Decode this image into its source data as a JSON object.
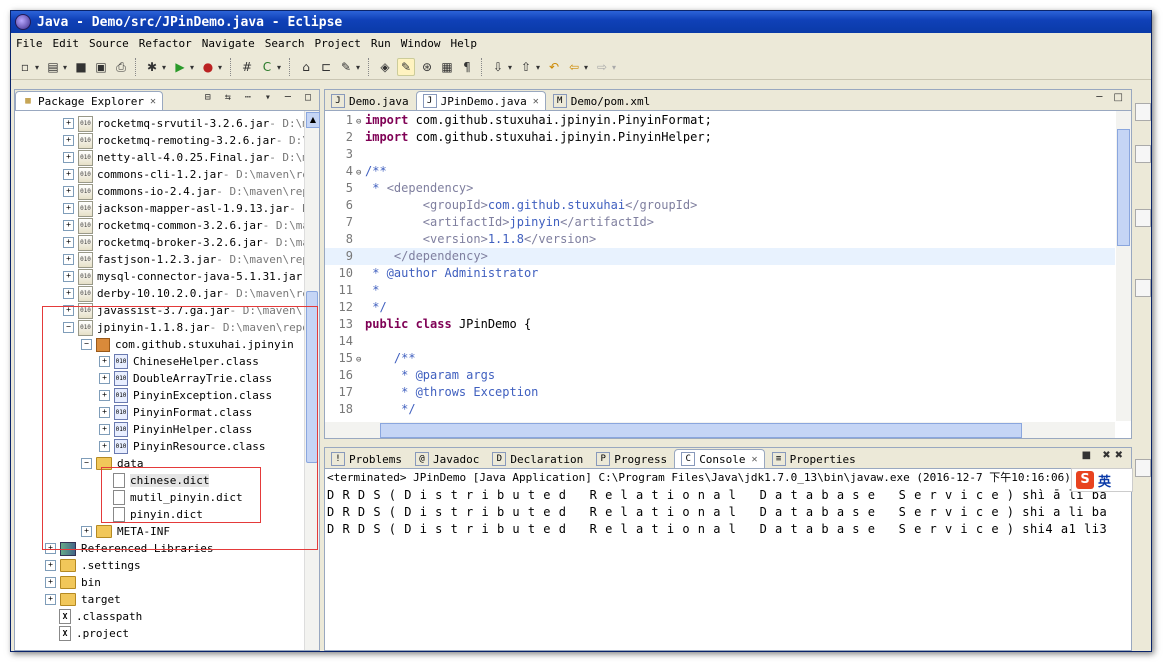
{
  "window": {
    "title": "Java - Demo/src/JPinDemo.java - Eclipse"
  },
  "menu": [
    "File",
    "Edit",
    "Source",
    "Refactor",
    "Navigate",
    "Search",
    "Project",
    "Run",
    "Window",
    "Help"
  ],
  "package_explorer": {
    "title": "Package Explorer",
    "items": [
      {
        "label": "rocketmq-srvutil-3.2.6.jar",
        "path": " - D:\\ma",
        "kind": "jar",
        "indent": 0
      },
      {
        "label": "rocketmq-remoting-3.2.6.jar",
        "path": " - D:\\m",
        "kind": "jar",
        "indent": 0
      },
      {
        "label": "netty-all-4.0.25.Final.jar",
        "path": " - D:\\ma",
        "kind": "jar",
        "indent": 0
      },
      {
        "label": "commons-cli-1.2.jar",
        "path": " - D:\\maven\\rep",
        "kind": "jar",
        "indent": 0
      },
      {
        "label": "commons-io-2.4.jar",
        "path": " - D:\\maven\\repo",
        "kind": "jar",
        "indent": 0
      },
      {
        "label": "jackson-mapper-asl-1.9.13.jar",
        "path": " - D:",
        "kind": "jar",
        "indent": 0
      },
      {
        "label": "rocketmq-common-3.2.6.jar",
        "path": " - D:\\mav",
        "kind": "jar",
        "indent": 0
      },
      {
        "label": "rocketmq-broker-3.2.6.jar",
        "path": " - D:\\mav",
        "kind": "jar",
        "indent": 0
      },
      {
        "label": "fastjson-1.2.3.jar",
        "path": " - D:\\maven\\repo",
        "kind": "jar",
        "indent": 0
      },
      {
        "label": "mysql-connector-java-5.1.31.jar",
        "path": " -",
        "kind": "jar",
        "indent": 0
      },
      {
        "label": "derby-10.10.2.0.jar",
        "path": " - D:\\maven\\rep",
        "kind": "jar",
        "indent": 0
      },
      {
        "label": "javassist-3.7.ga.jar",
        "path": " - D:\\maven\\re",
        "kind": "jar",
        "indent": 0
      },
      {
        "label": "jpinyin-1.1.8.jar",
        "path": " - D:\\maven\\repo\\",
        "kind": "jar",
        "indent": 0,
        "expanded": true
      },
      {
        "label": "com.github.stuxuhai.jpinyin",
        "path": "",
        "kind": "pkg",
        "indent": 1,
        "expanded": true
      },
      {
        "label": "ChineseHelper.class",
        "path": "",
        "kind": "cls",
        "indent": 2
      },
      {
        "label": "DoubleArrayTrie.class",
        "path": "",
        "kind": "cls",
        "indent": 2
      },
      {
        "label": "PinyinException.class",
        "path": "",
        "kind": "cls",
        "indent": 2
      },
      {
        "label": "PinyinFormat.class",
        "path": "",
        "kind": "cls",
        "indent": 2
      },
      {
        "label": "PinyinHelper.class",
        "path": "",
        "kind": "cls",
        "indent": 2
      },
      {
        "label": "PinyinResource.class",
        "path": "",
        "kind": "cls",
        "indent": 2
      },
      {
        "label": "data",
        "path": "",
        "kind": "fld",
        "indent": 1,
        "expanded": true
      },
      {
        "label": "chinese.dict",
        "path": "",
        "kind": "fil",
        "indent": 2,
        "selected": true
      },
      {
        "label": "mutil_pinyin.dict",
        "path": "",
        "kind": "fil",
        "indent": 2
      },
      {
        "label": "pinyin.dict",
        "path": "",
        "kind": "fil",
        "indent": 2
      },
      {
        "label": "META-INF",
        "path": "",
        "kind": "fld",
        "indent": 1
      },
      {
        "label": "Referenced Libraries",
        "path": "",
        "kind": "lib",
        "indent": -1
      },
      {
        "label": ".settings",
        "path": "",
        "kind": "fld",
        "indent": -1
      },
      {
        "label": "bin",
        "path": "",
        "kind": "fld",
        "indent": -1
      },
      {
        "label": "target",
        "path": "",
        "kind": "fld",
        "indent": -1
      },
      {
        "label": ".classpath",
        "path": "",
        "kind": "xml",
        "indent": -1
      },
      {
        "label": ".project",
        "path": "",
        "kind": "xml",
        "indent": -1
      }
    ]
  },
  "editor": {
    "tabs": [
      {
        "label": "Demo.java",
        "icon": "J"
      },
      {
        "label": "JPinDemo.java",
        "icon": "J",
        "active": true
      },
      {
        "label": "Demo/pom.xml",
        "icon": "M"
      }
    ],
    "lines": [
      {
        "n": "1",
        "fold": "⊖",
        "parts": [
          [
            "kw",
            "import"
          ],
          [
            "",
            "com.github.stuxuhai.jpinyin.PinyinFormat;"
          ]
        ]
      },
      {
        "n": "2",
        "fold": "",
        "parts": [
          [
            "kw",
            "import"
          ],
          [
            "",
            "com.github.stuxuhai.jpinyin.PinyinHelper;"
          ]
        ]
      },
      {
        "n": "3",
        "fold": "",
        "parts": []
      },
      {
        "n": "4",
        "fold": "⊖",
        "parts": [
          [
            "jd",
            "/**"
          ]
        ]
      },
      {
        "n": "5",
        "fold": "",
        "parts": [
          [
            "jd",
            " * "
          ],
          [
            "tag",
            "<dependency>"
          ]
        ]
      },
      {
        "n": "6",
        "fold": "",
        "parts": [
          [
            "jd",
            "        "
          ],
          [
            "tag",
            "<groupId>"
          ],
          [
            "jd",
            "com.github.stuxuhai"
          ],
          [
            "tag",
            "</groupId>"
          ]
        ]
      },
      {
        "n": "7",
        "fold": "",
        "parts": [
          [
            "jd",
            "        "
          ],
          [
            "tag",
            "<artifactId>"
          ],
          [
            "jd",
            "jpinyin"
          ],
          [
            "tag",
            "</artifactId>"
          ]
        ]
      },
      {
        "n": "8",
        "fold": "",
        "parts": [
          [
            "jd",
            "        "
          ],
          [
            "tag",
            "<version>"
          ],
          [
            "jd",
            "1.1.8"
          ],
          [
            "tag",
            "</version>"
          ]
        ]
      },
      {
        "n": "9",
        "fold": "",
        "parts": [
          [
            "jd",
            "    "
          ],
          [
            "tag",
            "</dependency>"
          ]
        ],
        "current": true
      },
      {
        "n": "10",
        "fold": "",
        "parts": [
          [
            "jd",
            " * @author Administrator"
          ]
        ]
      },
      {
        "n": "11",
        "fold": "",
        "parts": [
          [
            "jd",
            " *"
          ]
        ]
      },
      {
        "n": "12",
        "fold": "",
        "parts": [
          [
            "jd",
            " */"
          ]
        ]
      },
      {
        "n": "13",
        "fold": "",
        "parts": [
          [
            "kw",
            "public class"
          ],
          [
            "",
            "JPinDemo {"
          ]
        ]
      },
      {
        "n": "14",
        "fold": "",
        "parts": []
      },
      {
        "n": "15",
        "fold": "⊖",
        "parts": [
          [
            "jd",
            "    /**"
          ]
        ]
      },
      {
        "n": "16",
        "fold": "",
        "parts": [
          [
            "jd",
            "     * @param args"
          ]
        ]
      },
      {
        "n": "17",
        "fold": "",
        "parts": [
          [
            "jd",
            "     * @throws Exception"
          ]
        ]
      },
      {
        "n": "18",
        "fold": "",
        "parts": [
          [
            "jd",
            "     */"
          ]
        ]
      }
    ]
  },
  "console": {
    "tabs": [
      {
        "label": "Problems",
        "icon": "!"
      },
      {
        "label": "Javadoc",
        "icon": "@"
      },
      {
        "label": "Declaration",
        "icon": "D"
      },
      {
        "label": "Progress",
        "icon": "P"
      },
      {
        "label": "Console",
        "icon": "C",
        "active": true
      },
      {
        "label": "Properties",
        "icon": "≡"
      }
    ],
    "header": "<terminated> JPinDemo [Java Application] C:\\Program Files\\Java\\jdk1.7.0_13\\bin\\javaw.exe (2016-12-7 下午10:16:06)",
    "lines": [
      "D R D S ( D i s t r i b u t e d   R e l a t i o n a l   D a t a b a s e   S e r v i c e ) shì ā lì bā",
      "D R D S ( D i s t r i b u t e d   R e l a t i o n a l   D a t a b a s e   S e r v i c e ) shi a li ba",
      "D R D S ( D i s t r i b u t e d   R e l a t i o n a l   D a t a b a s e   S e r v i c e ) shi4 a1 li3"
    ],
    "ime": "英"
  },
  "colors": {
    "annotation": "#e43a3a",
    "titlebar": "#1041b8"
  }
}
